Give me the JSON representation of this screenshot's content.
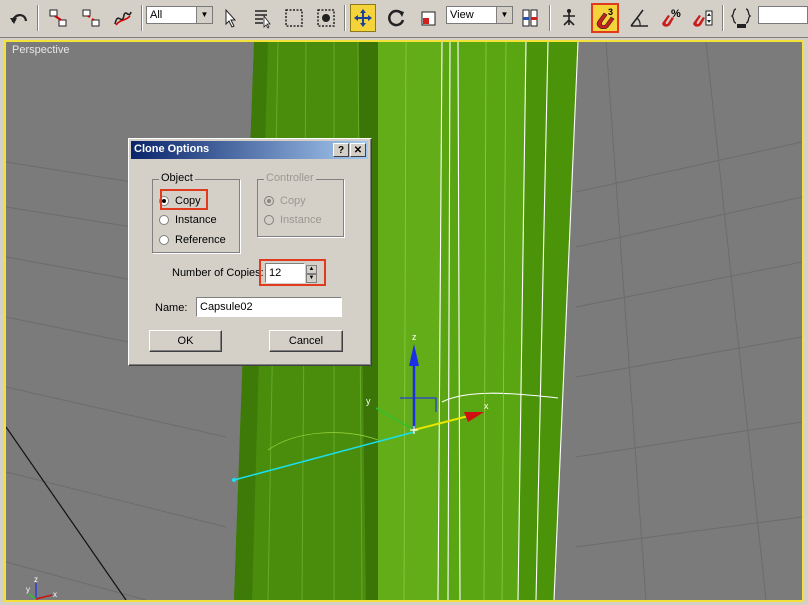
{
  "toolbar": {
    "selection_filter": "All",
    "reference_coord": "View",
    "snaps_badge": "3",
    "percent_snap_symbol": "%",
    "named_selection_value": ""
  },
  "viewport": {
    "label": "Perspective"
  },
  "gizmo": {
    "x_label": "x",
    "y_label": "y",
    "z_label": "z"
  },
  "tripod": {
    "x_label": "x",
    "y_label": "y",
    "z_label": "z"
  },
  "dialog": {
    "title": "Clone Options",
    "help_label": "?",
    "close_label": "✕",
    "object_group": {
      "label": "Object",
      "options": [
        "Copy",
        "Instance",
        "Reference"
      ],
      "selected": "Copy"
    },
    "controller_group": {
      "label": "Controller",
      "options": [
        "Copy",
        "Instance"
      ],
      "selected": "Copy",
      "enabled": false
    },
    "copies": {
      "label": "Number of Copies:",
      "value": "12"
    },
    "name": {
      "label": "Name:",
      "value": "Capsule02"
    },
    "ok_label": "OK",
    "cancel_label": "Cancel"
  },
  "colors": {
    "object_green": "#4f9a0c",
    "viewport_bg": "#7b7b7b",
    "active_viewport_border": "#f2e23a",
    "highlight_red": "#e03b1f",
    "titlebar": "#0a246a"
  }
}
